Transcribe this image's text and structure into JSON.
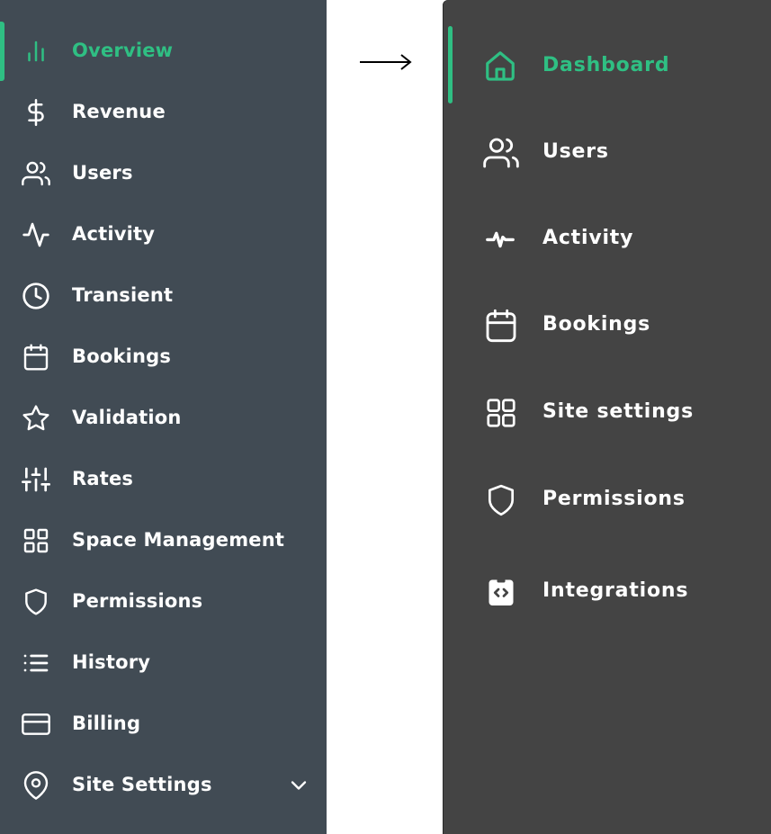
{
  "left_sidebar": {
    "items": [
      {
        "label": "Overview",
        "icon": "bar-chart-icon",
        "active": true
      },
      {
        "label": "Revenue",
        "icon": "dollar-icon"
      },
      {
        "label": "Users",
        "icon": "users-icon"
      },
      {
        "label": "Activity",
        "icon": "activity-icon"
      },
      {
        "label": "Transient",
        "icon": "clock-icon"
      },
      {
        "label": "Bookings",
        "icon": "calendar-icon"
      },
      {
        "label": "Validation",
        "icon": "star-icon"
      },
      {
        "label": "Rates",
        "icon": "sliders-icon"
      },
      {
        "label": "Space Management",
        "icon": "grid-icon"
      },
      {
        "label": "Permissions",
        "icon": "shield-icon"
      },
      {
        "label": "History",
        "icon": "list-icon"
      },
      {
        "label": "Billing",
        "icon": "credit-card-icon"
      },
      {
        "label": "Site Settings",
        "icon": "map-pin-icon",
        "expandable": true
      }
    ]
  },
  "right_sidebar": {
    "items": [
      {
        "label": "Dashboard",
        "icon": "home-icon",
        "active": true
      },
      {
        "label": "Users",
        "icon": "users-icon"
      },
      {
        "label": "Activity",
        "icon": "pulse-icon"
      },
      {
        "label": "Bookings",
        "icon": "calendar-icon"
      },
      {
        "label": "Site settings",
        "icon": "grid-icon"
      },
      {
        "label": "Permissions",
        "icon": "shield-icon"
      },
      {
        "label": "Integrations",
        "icon": "code-clipboard-icon"
      }
    ]
  },
  "colors": {
    "left_bg": "#414b54",
    "right_bg": "#444444",
    "accent": "#2fbf83",
    "text": "#ffffff"
  }
}
